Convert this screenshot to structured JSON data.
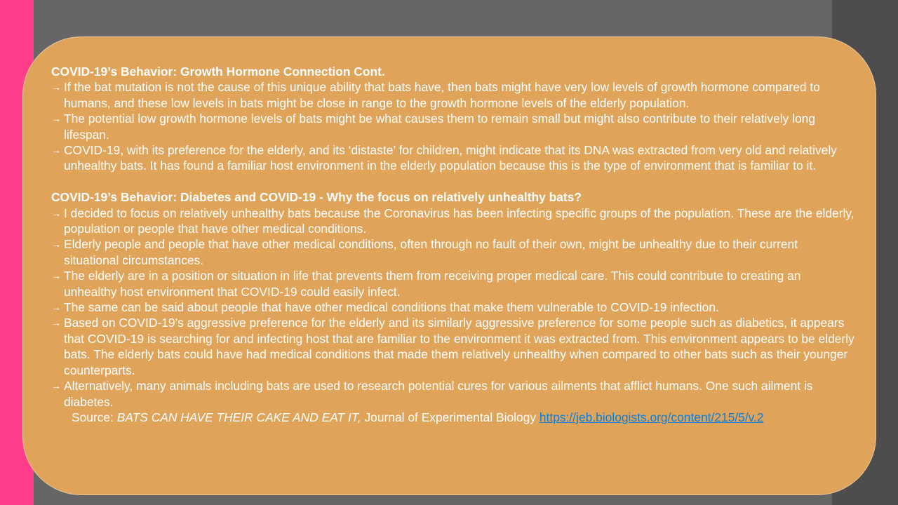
{
  "section1": {
    "heading": "COVID-19’s Behavior: Growth Hormone Connection Cont.",
    "items": [
      "If the bat mutation is not the cause of this unique ability that bats have, then bats might have very low levels of growth hormone compared to humans, and these low levels in bats might be close in range to the growth hormone levels of the elderly population.",
      "The potential low growth hormone levels of bats might be what causes them to remain small but might also contribute to their relatively long lifespan.",
      "COVID-19, with its preference for the elderly, and its ‘distaste’ for children, might indicate that its DNA was extracted from very old and relatively unhealthy bats. It has found a familiar host environment in the elderly population because this is the type of environment that is familiar to it."
    ]
  },
  "section2": {
    "heading": "COVID-19’s Behavior: Diabetes and COVID-19 - Why the focus on relatively unhealthy bats?",
    "items": [
      "I decided to focus on relatively unhealthy bats because the Coronavirus has been infecting specific groups of the population. These are the elderly, population or people that have other medical conditions.",
      "Elderly people and people that have other medical conditions, often through no fault of their own, might be unhealthy due to their current situational circumstances.",
      "The elderly are in a position or situation in life that prevents them from receiving proper medical care. This could contribute to creating an unhealthy host environment that COVID-19 could easily infect.",
      "The same can be said about people that have other medical conditions that make them vulnerable to COVID-19 infection.",
      "Based on COVID-19’s aggressive preference for the elderly and its similarly aggressive preference for some people such as diabetics,  it appears that COVID-19 is searching for and infecting host that are familiar to the environment it was extracted from. This environment appears to be elderly bats. The elderly bats could have had medical conditions that made them relatively unhealthy when compared to other bats such as their younger counterparts.",
      "Alternatively, many animals including bats are used to research potential cures for various ailments that afflict humans. One such ailment is diabetes."
    ]
  },
  "source": {
    "prefix": "Source: ",
    "title": "BATS CAN HAVE THEIR CAKE AND EAT IT,",
    "journal": " Journal of Experimental Biology ",
    "link": "https://jeb.biologists.org/content/215/5/v.2"
  },
  "bullet_glyph": "→",
  "colors": {
    "background": "#666666",
    "left_bar": "#ff3d8b",
    "right_bar": "#4d4d4d",
    "card": "#dfa35a",
    "text": "#ffffff",
    "link": "#0c7fd9"
  }
}
